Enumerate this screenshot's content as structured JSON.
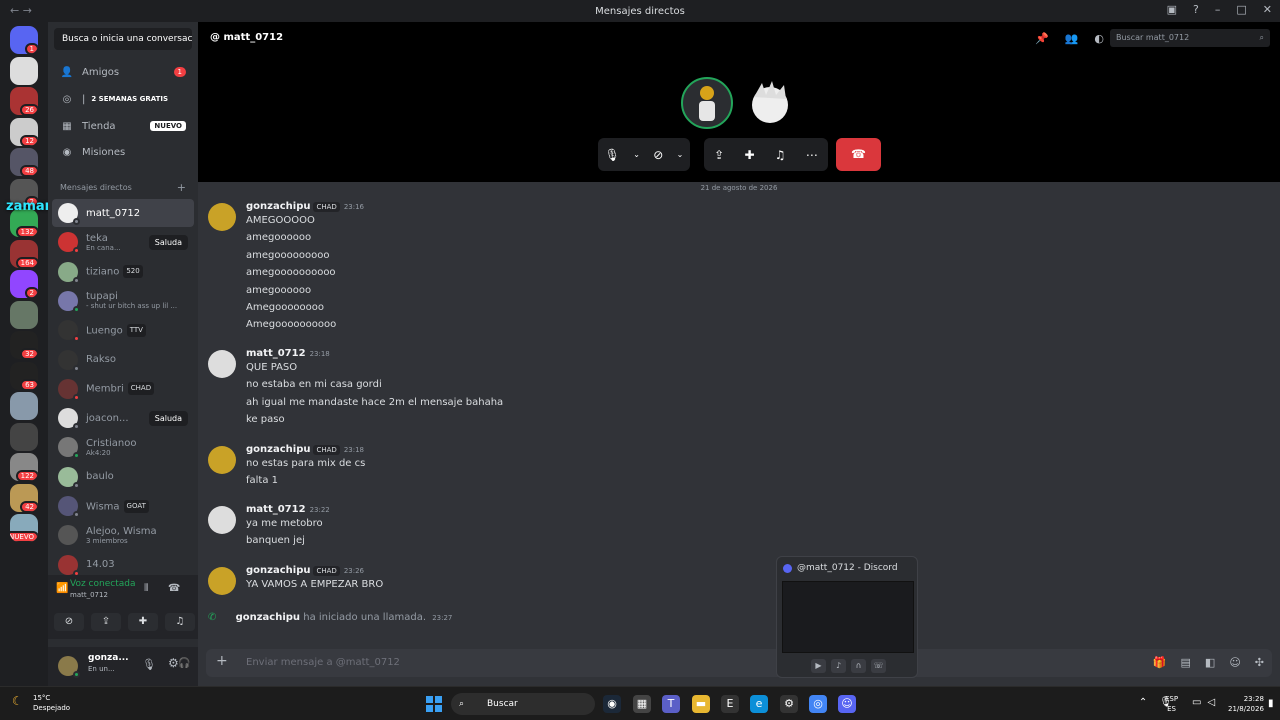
{
  "window": {
    "title": "Mensajes directos"
  },
  "guilds": [
    {
      "badge": "1"
    },
    {
      "badge": ""
    },
    {
      "badge": "26"
    },
    {
      "badge": "12"
    },
    {
      "badge": "48"
    },
    {
      "badge": "2"
    },
    {
      "badge": "132"
    },
    {
      "badge": "164"
    },
    {
      "badge": "2"
    },
    {
      "badge": ""
    },
    {
      "badge": "32"
    },
    {
      "badge": "63"
    },
    {
      "badge": ""
    },
    {
      "badge": ""
    },
    {
      "badge": "122"
    },
    {
      "badge": "42"
    },
    {
      "badge": "NUEVO"
    }
  ],
  "overlay_text": "zamamon :",
  "sidebar": {
    "search": "Busca o inicia una conversaci...",
    "friends": {
      "label": "Amigos",
      "badge": "1"
    },
    "nitro": {
      "label": "2 SEMANAS GRATIS"
    },
    "shop": {
      "label": "Tienda",
      "badge": "NUEVO"
    },
    "missions": {
      "label": "Misiones"
    },
    "dm_title": "Mensajes directos",
    "dms": [
      {
        "name": "matt_0712",
        "sub": "",
        "tag": "",
        "action": "",
        "status": "off"
      },
      {
        "name": "teka",
        "sub": "En cana...",
        "tag": "",
        "action": "Saluda",
        "status": "dnd"
      },
      {
        "name": "tiziano",
        "sub": "",
        "tag": "520",
        "action": "",
        "status": "off"
      },
      {
        "name": "tupapi",
        "sub": "- shut ur bitch ass up lil ...",
        "tag": "",
        "action": "",
        "status": "on"
      },
      {
        "name": "Luengo",
        "sub": "",
        "tag": "TTV",
        "action": "",
        "status": "dnd"
      },
      {
        "name": "Rakso",
        "sub": "",
        "tag": "",
        "action": "",
        "status": "off"
      },
      {
        "name": "Membri",
        "sub": "",
        "tag": "CHAD",
        "action": "",
        "status": "dnd"
      },
      {
        "name": "joacon...",
        "sub": "",
        "tag": "",
        "action": "Saluda",
        "status": "off"
      },
      {
        "name": "Cristianoo",
        "sub": "Ak4:20",
        "tag": "",
        "action": "",
        "status": "on"
      },
      {
        "name": "baulo",
        "sub": "",
        "tag": "",
        "action": "",
        "status": "off"
      },
      {
        "name": "Wisma",
        "sub": "",
        "tag": "GOAT",
        "action": "",
        "status": "off"
      },
      {
        "name": "Alejoo, Wisma",
        "sub": "3 miembros",
        "tag": "",
        "action": "",
        "status": ""
      },
      {
        "name": "14.03",
        "sub": "",
        "tag": "",
        "action": "",
        "status": "dnd"
      }
    ],
    "voice": {
      "title": "Voz conectada",
      "channel": "matt_0712"
    },
    "user": {
      "name": "gonza...",
      "status": "En un..."
    }
  },
  "header": {
    "channel": "matt_0712",
    "search_placeholder": "Buscar matt_0712"
  },
  "date_divider": "21 de agosto de 2026",
  "messages": [
    {
      "author": "gonzachipu",
      "badge": "CHAD",
      "time": "23:16",
      "lines": [
        "AMEGOOOOO",
        "amegoooooo",
        "amegooooooooo",
        "amegoooooooooo",
        "amegoooooo",
        "Amegoooooooo",
        "Amegoooooooooo"
      ]
    },
    {
      "author": "matt_0712",
      "badge": "",
      "time": "23:18",
      "lines": [
        "QUE PASO",
        "no estaba en mi casa gordi",
        "ah igual me mandaste hace 2m el mensaje bahaha",
        "ke paso"
      ]
    },
    {
      "author": "gonzachipu",
      "badge": "CHAD",
      "time": "23:18",
      "lines": [
        "no estas para mix de cs",
        "falta 1"
      ]
    },
    {
      "author": "matt_0712",
      "badge": "",
      "time": "23:22",
      "lines": [
        "ya me metobro",
        "banquen jej"
      ]
    },
    {
      "author": "gonzachipu",
      "badge": "CHAD",
      "time": "23:26",
      "lines": [
        "YA VAMOS A EMPEZAR BRO"
      ]
    }
  ],
  "system_message": {
    "author": "gonzachipu",
    "text": "ha iniciado una llamada.",
    "time": "23:27"
  },
  "composer": {
    "placeholder": "Enviar mensaje a @matt_0712"
  },
  "popup": {
    "title": "@matt_0712 - Discord"
  },
  "taskbar": {
    "weather_temp": "15°C",
    "weather_desc": "Despejado",
    "search": "Buscar",
    "lang1": "ESP",
    "lang2": "ES",
    "time": "23:28",
    "date": "21/8/2026"
  },
  "colors": {
    "accent": "#5865f2",
    "danger": "#da373c",
    "online": "#23a55a"
  }
}
